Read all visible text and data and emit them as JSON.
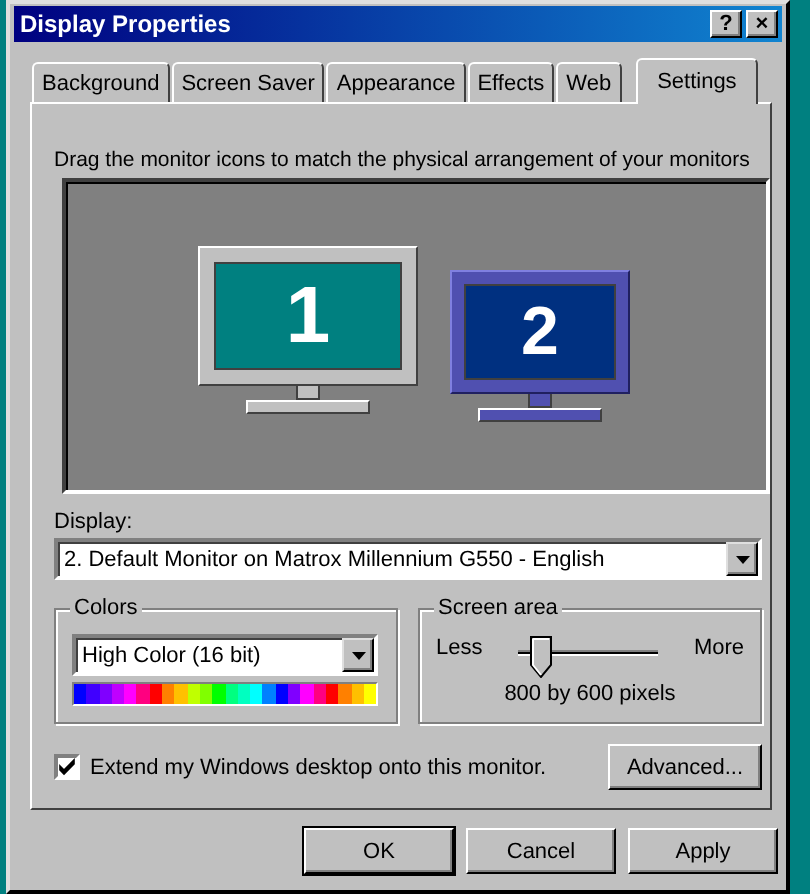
{
  "window": {
    "title": "Display Properties",
    "help_button": "?",
    "close_button": "×"
  },
  "tabs": [
    {
      "label": "Background",
      "selected": false
    },
    {
      "label": "Screen Saver",
      "selected": false
    },
    {
      "label": "Appearance",
      "selected": false
    },
    {
      "label": "Effects",
      "selected": false
    },
    {
      "label": "Web",
      "selected": false
    },
    {
      "label": "Settings",
      "selected": true
    }
  ],
  "instruction": "Drag the monitor icons to match the physical arrangement of your monitors",
  "monitors": [
    {
      "number": "1",
      "selected": false
    },
    {
      "number": "2",
      "selected": true
    }
  ],
  "display": {
    "label": "Display:",
    "value": "2. Default Monitor on Matrox Millennium G550 - English"
  },
  "colors": {
    "title": "Colors",
    "value": "High Color (16 bit)"
  },
  "screen_area": {
    "title": "Screen area",
    "min_label": "Less",
    "max_label": "More",
    "level": 0.15,
    "reading": "800 by 600 pixels"
  },
  "extend_checkbox": {
    "label": "Extend my Windows desktop onto this monitor.",
    "checked": true
  },
  "advanced_button": "Advanced...",
  "buttons": [
    "OK",
    "Cancel",
    "Apply"
  ]
}
